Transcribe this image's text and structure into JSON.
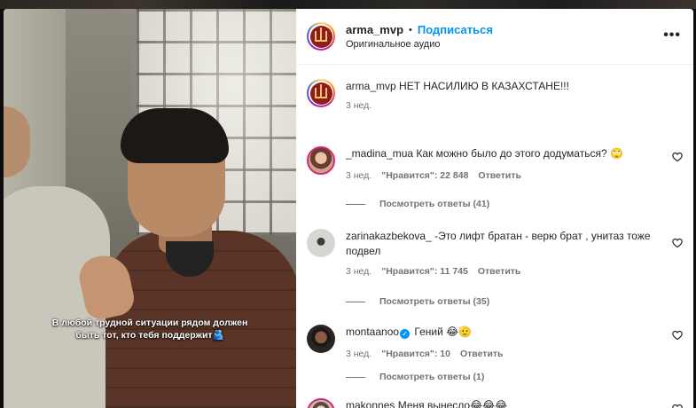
{
  "video": {
    "caption_lines": [
      "В любой трудной ситуации рядом должен",
      "быть тот, кто тебя поддержит🫂"
    ]
  },
  "header": {
    "username": "arma_mvp",
    "separator": "•",
    "follow_label": "Подписаться",
    "audio_label": "Оригинальное аудио",
    "more_label": "•••"
  },
  "post_caption": {
    "username": "arma_mvp",
    "text": "НЕТ НАСИЛИЮ В КАЗАХСТАНЕ!!!",
    "date": "3 нед."
  },
  "comments": [
    {
      "username": "_madina_mua",
      "text": "Как можно было до этого додуматься? 🙄",
      "date": "3 нед.",
      "likes": "\"Нравится\": 22 848",
      "reply": "Ответить",
      "view_replies": "Посмотреть ответы (41)",
      "avatar_color": "#c9a38e"
    },
    {
      "username": "zarinakazbekova_",
      "text": "-Это лифт братан - верю брат , унитаз тоже подвел",
      "date": "3 нед.",
      "likes": "\"Нравится\": 11 745",
      "reply": "Ответить",
      "view_replies": "Посмотреть ответы (35)",
      "avatar_color": "#d7d6d2"
    },
    {
      "username": "montaanoo",
      "text": "Гений 😂🫡",
      "date": "3 нед.",
      "likes": "\"Нравится\": 10",
      "reply": "Ответить",
      "view_replies": "Посмотреть ответы (1)",
      "avatar_color": "#2a2522",
      "verified": true
    },
    {
      "username": "makonnes",
      "text": "Меня вынесло😂😂😂",
      "avatar_color": "#c7bcb2"
    }
  ],
  "colors": {
    "accent": "#0095f6",
    "text": "#262626",
    "secondary": "#737373"
  }
}
